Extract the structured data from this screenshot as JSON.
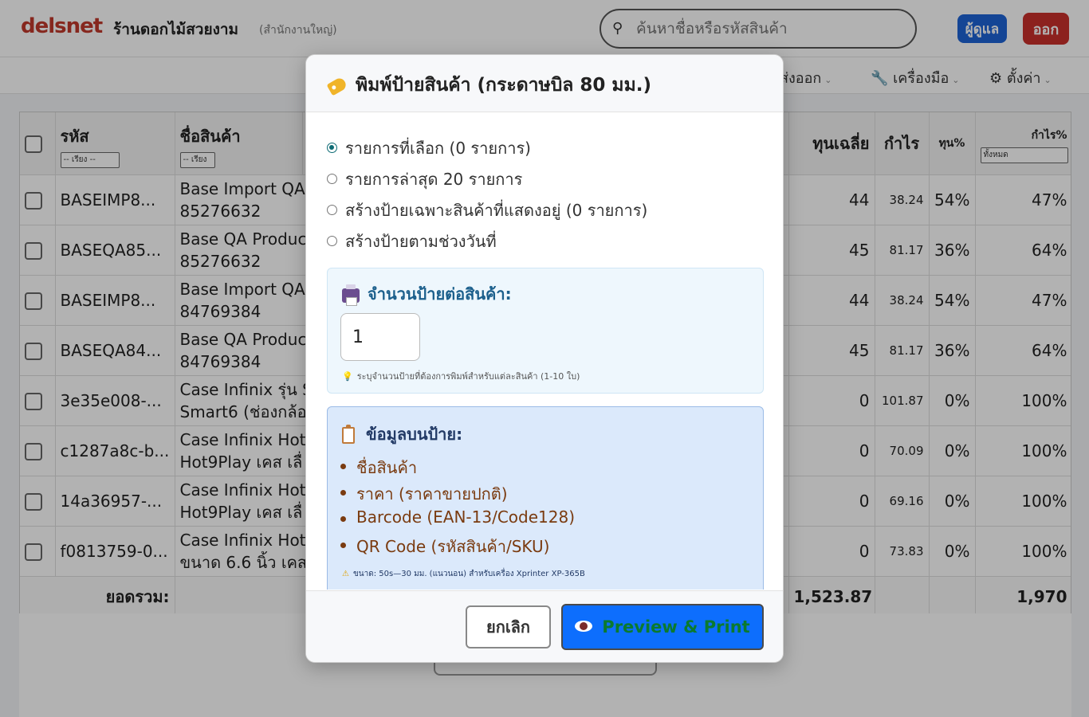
{
  "app": {
    "logo": "delsnet",
    "shop_name": "ร้านดอกไม้สวยงาม",
    "branch": "(สำนักงานใหญ่)",
    "search_placeholder": "ค้นหาชื่อหรือรหัสสินค้า",
    "admin_label": "ผู้ดูแล",
    "logout_label": "ออก"
  },
  "menu": {
    "export_label": "ส่งออก",
    "tools_label": "เครื่องมือ",
    "settings_label": "ตั้งค่า"
  },
  "table": {
    "headers": {
      "code": "รหัส",
      "name": "ชื่อสินค้า",
      "avg_cost": "ทุนเฉลี่ย",
      "profit": "กำไร",
      "cost_pct": "ทุน%",
      "profit_pct": "กำไร%"
    },
    "sort_label": "-- เรียง --",
    "sort_label_short": "-- เรียง",
    "filter_label": "ทั้งหมด",
    "rows": [
      {
        "code": "BASEIMP8...",
        "name1": "Base Import QA",
        "name2": "85276632",
        "avg_cost": "44",
        "profit": "38.24",
        "cost_pct": "54%",
        "profit_pct": "47%"
      },
      {
        "code": "BASEQA85...",
        "name1": "Base QA Produc",
        "name2": "85276632",
        "avg_cost": "45",
        "profit": "81.17",
        "cost_pct": "36%",
        "profit_pct": "64%"
      },
      {
        "code": "BASEIMP8...",
        "name1": "Base Import QA",
        "name2": "84769384",
        "avg_cost": "44",
        "profit": "38.24",
        "cost_pct": "54%",
        "profit_pct": "47%"
      },
      {
        "code": "BASEQA84...",
        "name1": "Base QA Produc",
        "name2": "84769384",
        "avg_cost": "45",
        "profit": "81.17",
        "cost_pct": "36%",
        "profit_pct": "64%"
      },
      {
        "code": "3e35e008-...",
        "name1": "Case Infinix รุ่น S",
        "name2": "Smart6 (ช่องกล้อ",
        "avg_cost": "0",
        "profit": "101.87",
        "cost_pct": "0%",
        "profit_pct": "100%"
      },
      {
        "code": "c1287a8c-b...",
        "name1": "Case Infinix Hot",
        "name2": "Hot9Play เคส เลื่",
        "avg_cost": "0",
        "profit": "70.09",
        "cost_pct": "0%",
        "profit_pct": "100%"
      },
      {
        "code": "14a36957-...",
        "name1": "Case Infinix Hot",
        "name2": "Hot9Play เคส เลื่",
        "avg_cost": "0",
        "profit": "69.16",
        "cost_pct": "0%",
        "profit_pct": "100%"
      },
      {
        "code": "f0813759-0...",
        "name1": "Case Infinix Hot",
        "name2": "ขนาด 6.6 นิ้ว เคส",
        "avg_cost": "0",
        "profit": "73.83",
        "cost_pct": "0%",
        "profit_pct": "100%"
      }
    ],
    "total_label": "ยอดรวม:",
    "total_avg_cost": "1,523.87",
    "total_profit_pct": "1,970"
  },
  "modal": {
    "title": "พิมพ์ป้ายสินค้า (กระดาษบิล 80 มม.)",
    "options": [
      {
        "label": "รายการที่เลือก (0 รายการ)",
        "checked": true
      },
      {
        "label": "รายการล่าสุด 20 รายการ",
        "checked": false
      },
      {
        "label": "สร้างป้ายเฉพาะสินค้าที่แสดงอยู่ (0 รายการ)",
        "checked": false
      },
      {
        "label": "สร้างป้ายตามช่วงวันที่",
        "checked": false
      }
    ],
    "qty_title": "จำนวนป้ายต่อสินค้า:",
    "qty_value": "1",
    "qty_hint": "ระบุจำนวนป้ายที่ต้องการพิมพ์สำหรับแต่ละสินค้า (1-10 ใบ)",
    "info_title": "ข้อมูลบนป้าย:",
    "info_items": [
      "ชื่อสินค้า",
      "ราคา (ราคาขายปกติ)",
      "Barcode (EAN-13/Code128)",
      "QR Code (รหัสสินค้า/SKU)"
    ],
    "info_note": "ขนาด: 50s—30 มม. (แนวนอน) สำหรับเครื่อง Xprinter XP-365B",
    "cancel_label": "ยกเลิก",
    "print_label": "Preview & Print"
  },
  "colors": {
    "primary": "#0d6efd",
    "danger": "#c9302c",
    "brand": "#c0392b",
    "print_text": "#0b7a2e"
  }
}
